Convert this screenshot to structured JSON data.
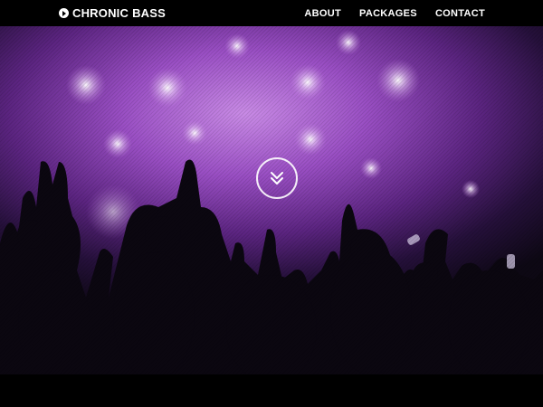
{
  "brand": {
    "icon": "play-circle-icon",
    "name_part1": "CHRONIC",
    "name_part2": "BASS"
  },
  "nav": {
    "items": [
      {
        "label": "ABOUT"
      },
      {
        "label": "PACKAGES"
      },
      {
        "label": "CONTACT"
      }
    ]
  },
  "hero": {
    "scroll_icon": "double-chevron-down-icon",
    "accent_color": "#9a4fc4"
  }
}
